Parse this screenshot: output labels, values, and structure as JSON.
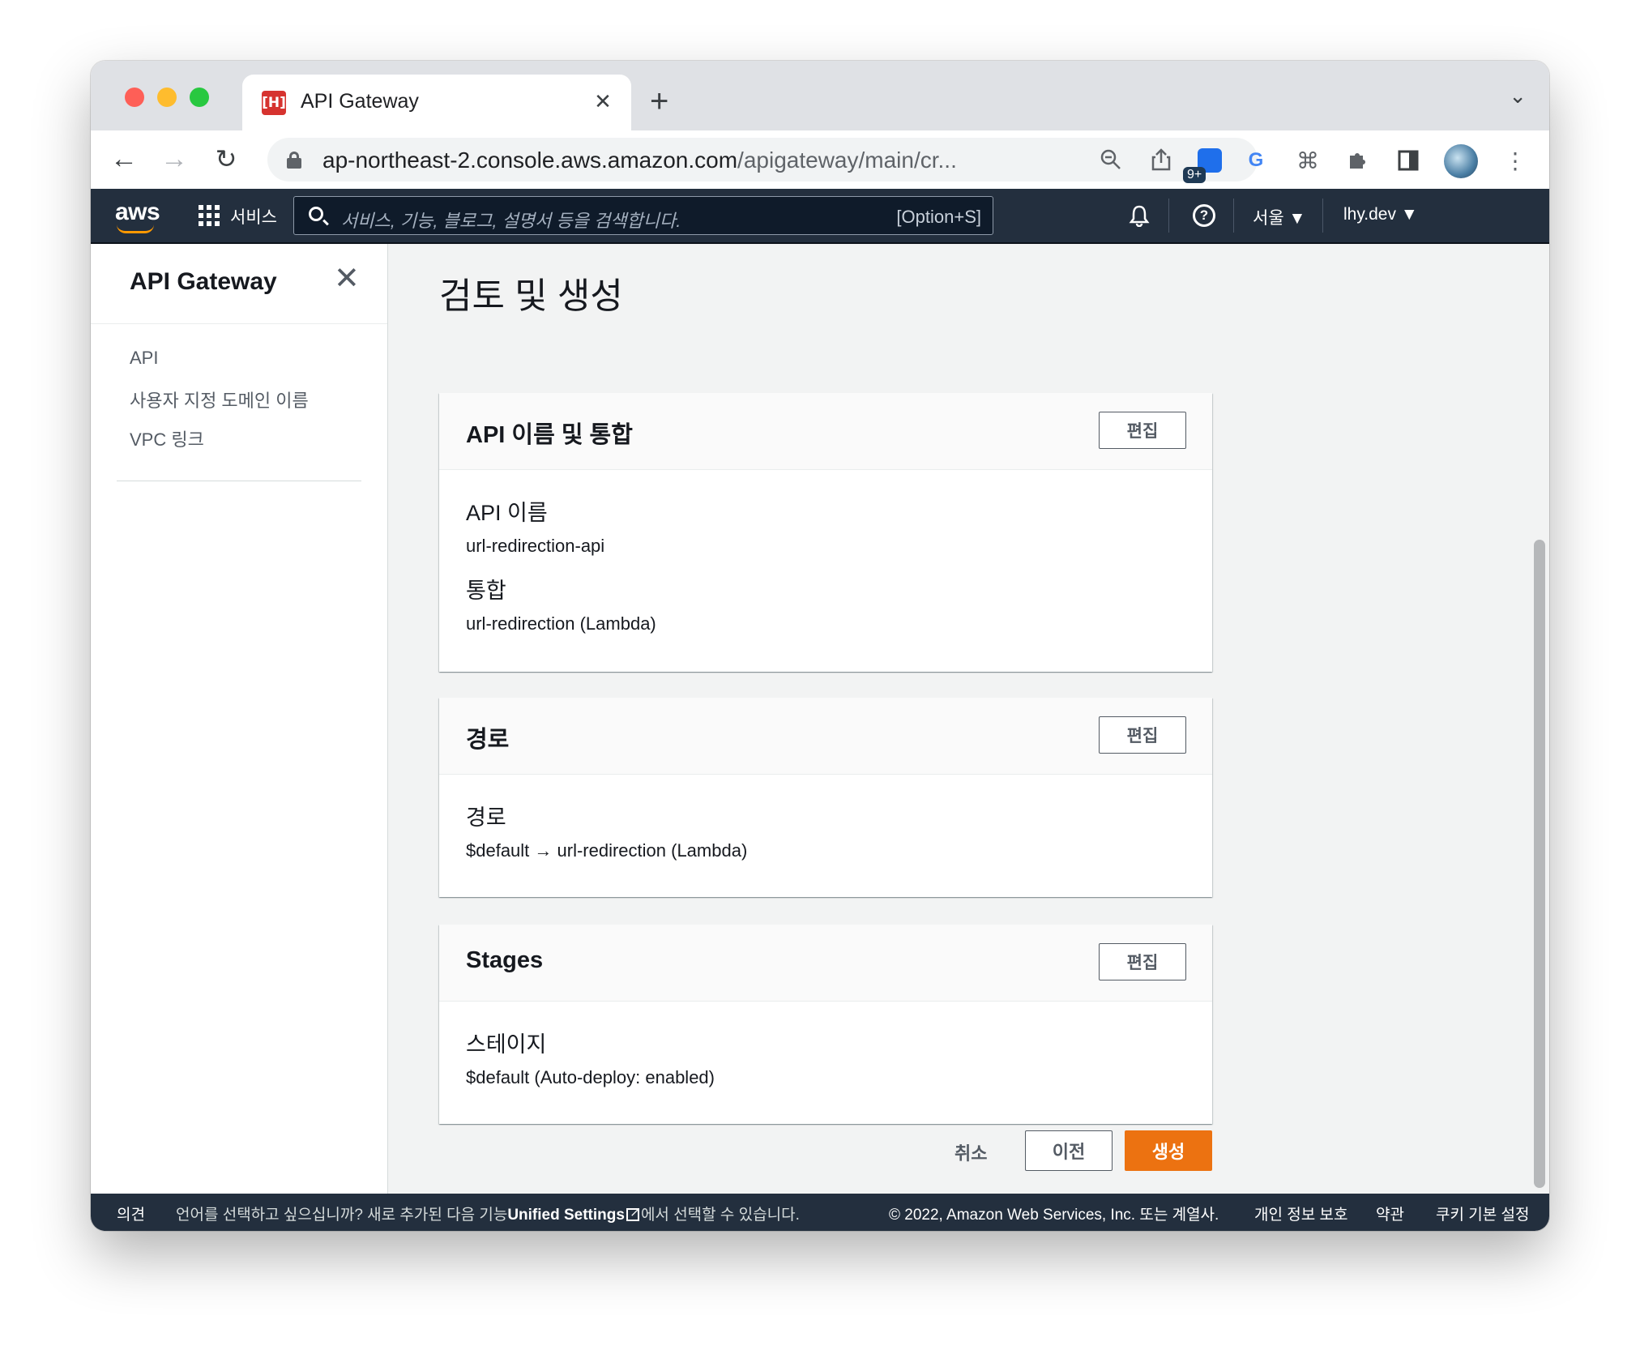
{
  "browser": {
    "tab_title": "API Gateway",
    "tab_favicon_glyph": "[H]",
    "url_host": "ap-northeast-2.console.aws.amazon.com",
    "url_path": "/apigateway/main/cr...",
    "extension_badge": "9+"
  },
  "aws_nav": {
    "logo": "aws",
    "services_label": "서비스",
    "search_placeholder": "서비스, 기능, 블로그, 설명서 등을 검색합니다.",
    "search_shortcut": "[Option+S]",
    "region": "서울 ▼",
    "account": "lhy.dev ▼"
  },
  "sidebar": {
    "title": "API Gateway",
    "items": [
      {
        "label": "API"
      },
      {
        "label": "사용자 지정 도메인 이름"
      },
      {
        "label": "VPC 링크"
      }
    ]
  },
  "main": {
    "page_title": "검토 및 생성",
    "edit_label": "편집",
    "cards": [
      {
        "title": "API 이름 및 통합",
        "fields": [
          {
            "label": "API 이름",
            "value": "url-redirection-api"
          },
          {
            "label": "통합",
            "value": "url-redirection (Lambda)"
          }
        ]
      },
      {
        "title": "경로",
        "fields": [
          {
            "label": "경로",
            "value": "$default → url-redirection (Lambda)"
          }
        ]
      },
      {
        "title": "Stages",
        "fields": [
          {
            "label": "스테이지",
            "value": "$default (Auto-deploy: enabled)"
          }
        ]
      }
    ],
    "actions": {
      "cancel": "취소",
      "previous": "이전",
      "create": "생성"
    }
  },
  "footer": {
    "feedback": "의견",
    "language_prefix": "언어를 선택하고 싶으십니까? 새로 추가된 다음 기능",
    "language_link": "Unified Settings",
    "language_suffix": "에서 선택할 수 있습니다.",
    "copyright": "© 2022, Amazon Web Services, Inc. 또는 계열사.",
    "privacy": "개인 정보 보호",
    "terms": "약관",
    "cookies": "쿠키 기본 설정"
  },
  "colors": {
    "aws_nav_bg": "#232f3e",
    "primary_button": "#ec7211",
    "page_bg": "#f2f3f3"
  }
}
